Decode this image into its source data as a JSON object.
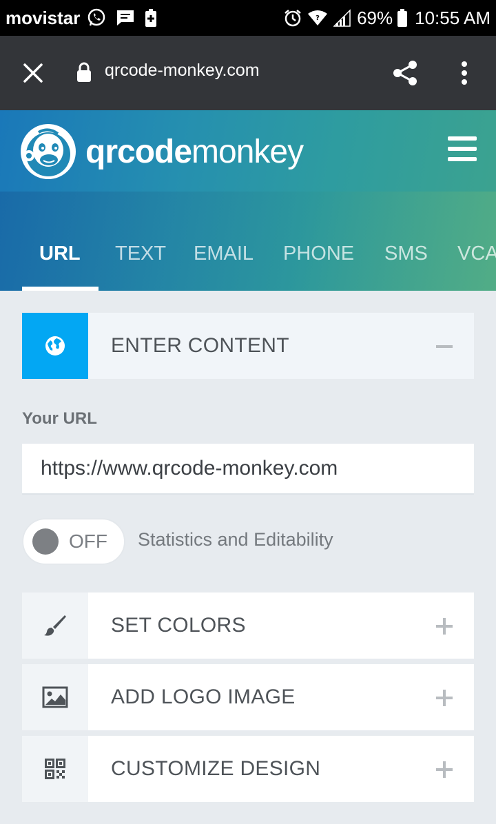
{
  "status_bar": {
    "carrier": "movistar",
    "battery_percent": "69%",
    "time": "10:55 AM",
    "left_icons": [
      "whatsapp-icon",
      "message-icon",
      "battery-saver-icon"
    ],
    "right_icons": [
      "alarm-icon",
      "wifi-icon",
      "signal-icon",
      "battery-icon"
    ]
  },
  "browser": {
    "url": "qrcode-monkey.com",
    "icons": [
      "close-icon",
      "lock-icon",
      "share-icon",
      "overflow-menu-icon"
    ]
  },
  "site": {
    "logo_bold": "qrcode",
    "logo_light": "monkey",
    "tabs": [
      {
        "label": "URL",
        "active": true
      },
      {
        "label": "TEXT",
        "active": false
      },
      {
        "label": "EMAIL",
        "active": false
      },
      {
        "label": "PHONE",
        "active": false
      },
      {
        "label": "SMS",
        "active": false
      },
      {
        "label": "VCA",
        "active": false
      }
    ]
  },
  "content": {
    "enter_content": {
      "label": "ENTER CONTENT",
      "icon": "globe-icon",
      "toggle": "collapse"
    },
    "url_label": "Your URL",
    "url_value": "https://www.qrcode-monkey.com",
    "statistics_toggle": {
      "state": "OFF",
      "caption": "Statistics and Editability"
    },
    "panels": [
      {
        "label": "SET COLORS",
        "icon": "paint-brush-icon",
        "toggle": "expand"
      },
      {
        "label": "ADD LOGO IMAGE",
        "icon": "image-icon",
        "toggle": "expand"
      },
      {
        "label": "CUSTOMIZE DESIGN",
        "icon": "qr-code-icon",
        "toggle": "expand"
      }
    ]
  },
  "colors": {
    "status_bar_bg": "#000000",
    "browser_bar_bg": "#333539",
    "accent_blue": "#03a7f3",
    "page_bg": "#e7ebef"
  }
}
